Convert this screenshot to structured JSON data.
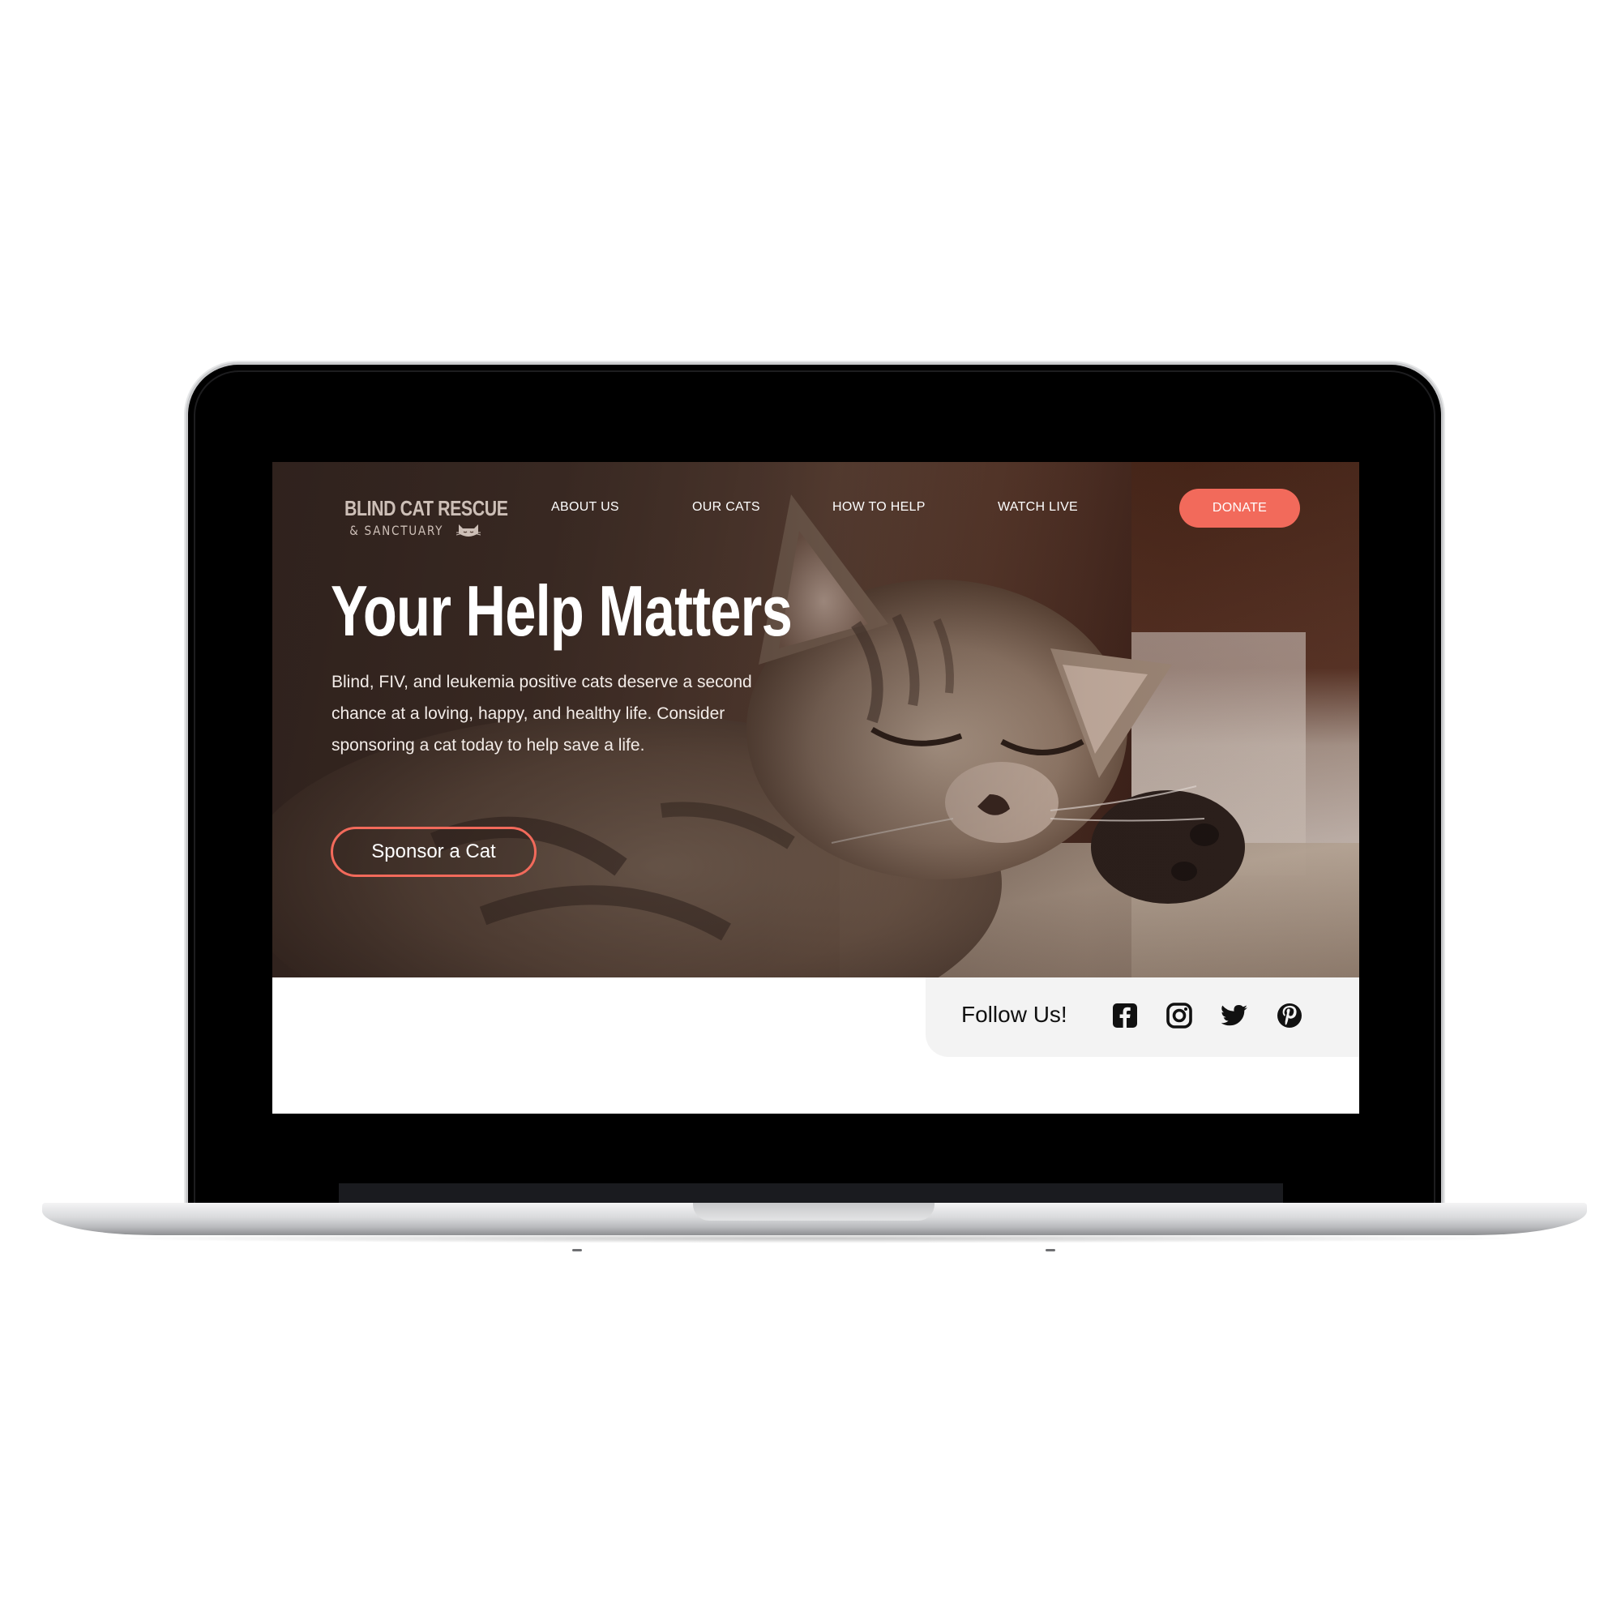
{
  "logo": {
    "main": "BLIND CAT RESCUE",
    "sub": "& SANCTUARY",
    "icon": "cat-face-icon"
  },
  "nav": {
    "items": [
      {
        "label": "ABOUT US"
      },
      {
        "label": "OUR CATS"
      },
      {
        "label": "HOW TO HELP"
      },
      {
        "label": "WATCH LIVE"
      }
    ],
    "donate_label": "DONATE"
  },
  "hero": {
    "title": "Your Help Matters",
    "description": "Blind, FIV, and leukemia positive cats deserve a second chance at a loving, happy, and healthy life. Consider sponsoring a cat today to help save a life.",
    "cta_label": "Sponsor a Cat",
    "image": "sleeping-kitten-photo"
  },
  "follow": {
    "label": "Follow Us!",
    "icons": [
      "facebook-icon",
      "instagram-icon",
      "twitter-icon",
      "pinterest-icon"
    ]
  },
  "colors": {
    "accent": "#f26a5b",
    "follow_bg": "#f3f3f3",
    "logo_text": "#cdbfb7"
  }
}
